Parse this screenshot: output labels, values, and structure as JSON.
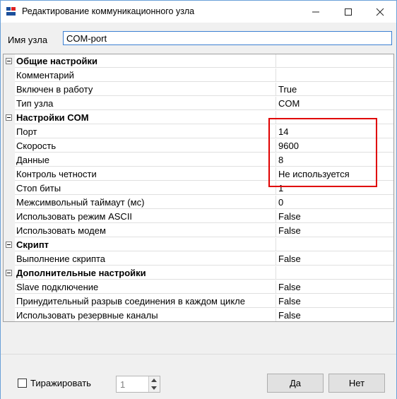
{
  "window": {
    "title": "Редактирование  коммуникационного узла",
    "app_icon": "app-logo-icon"
  },
  "name_field": {
    "label": "Имя узла",
    "value": "COM-port"
  },
  "grid": {
    "rows": [
      {
        "type": "category",
        "label": "Общие настройки",
        "value": ""
      },
      {
        "type": "property",
        "label": "Комментарий",
        "value": ""
      },
      {
        "type": "property",
        "label": "Включен в работу",
        "value": "True"
      },
      {
        "type": "property",
        "label": "Тип узла",
        "value": "COM"
      },
      {
        "type": "category",
        "label": "Настройки COM",
        "value": ""
      },
      {
        "type": "property",
        "label": "Порт",
        "value": "14"
      },
      {
        "type": "property",
        "label": "Скорость",
        "value": "9600"
      },
      {
        "type": "property",
        "label": "Данные",
        "value": "8"
      },
      {
        "type": "property",
        "label": "Контроль четности",
        "value": "Не используется"
      },
      {
        "type": "property",
        "label": "Стоп биты",
        "value": "1"
      },
      {
        "type": "property",
        "label": "Межсимвольный таймаут (мс)",
        "value": "0"
      },
      {
        "type": "property",
        "label": "Использовать режим ASCII",
        "value": "False"
      },
      {
        "type": "property",
        "label": "Использовать модем",
        "value": "False"
      },
      {
        "type": "category",
        "label": "Скрипт",
        "value": ""
      },
      {
        "type": "property",
        "label": "Выполнение скрипта",
        "value": "False"
      },
      {
        "type": "category",
        "label": "Дополнительные настройки",
        "value": ""
      },
      {
        "type": "property",
        "label": "Slave подключение",
        "value": "False"
      },
      {
        "type": "property",
        "label": "Принудительный разрыв соединения в каждом цикле",
        "value": "False"
      },
      {
        "type": "property",
        "label": "Использовать резервные каналы",
        "value": "False"
      }
    ]
  },
  "highlight_color": "#e00000",
  "bottom": {
    "replicate_label": "Тиражировать",
    "replicate_checked": false,
    "count_value": "1",
    "ok_label": "Да",
    "cancel_label": "Нет"
  }
}
